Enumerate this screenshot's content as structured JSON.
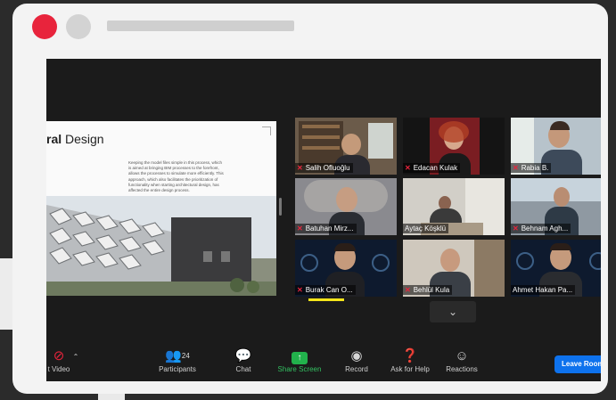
{
  "colors": {
    "accent_red": "#e8243c",
    "share_green": "#22b24c",
    "leave_blue": "#0e72ed",
    "speaker_yellow": "#f5e51a"
  },
  "slide": {
    "title_bold": "ral",
    "title_rest": " Design",
    "body": "Keeping the model files simple in this process, which is aimed at bringing BIM processes to the forefront, allows the processes to simulate more efficiently. This approach, which also facilitates the prioritization of functionality when starting architectural design, has affected the entire design process."
  },
  "participants": [
    {
      "name": "Salih Ofluoğlu",
      "muted": true
    },
    {
      "name": "Edacan Kulak",
      "muted": true
    },
    {
      "name": "Rabia B.",
      "muted": true
    },
    {
      "name": "Batuhan Mirz...",
      "muted": true
    },
    {
      "name": "Aytaç Köşklü",
      "muted": false
    },
    {
      "name": "Behnam Agh...",
      "muted": true
    },
    {
      "name": "Burak Can O...",
      "muted": true
    },
    {
      "name": "Behlül Kula",
      "muted": true
    },
    {
      "name": "Ahmet Hakan Pa...",
      "muted": false
    }
  ],
  "toolbar": {
    "video_label": "t Video",
    "participants_label": "Participants",
    "participants_count": "24",
    "chat_label": "Chat",
    "share_label": "Share Screen",
    "record_label": "Record",
    "help_label": "Ask for Help",
    "reactions_label": "Reactions",
    "leave_label": "Leave Room"
  }
}
